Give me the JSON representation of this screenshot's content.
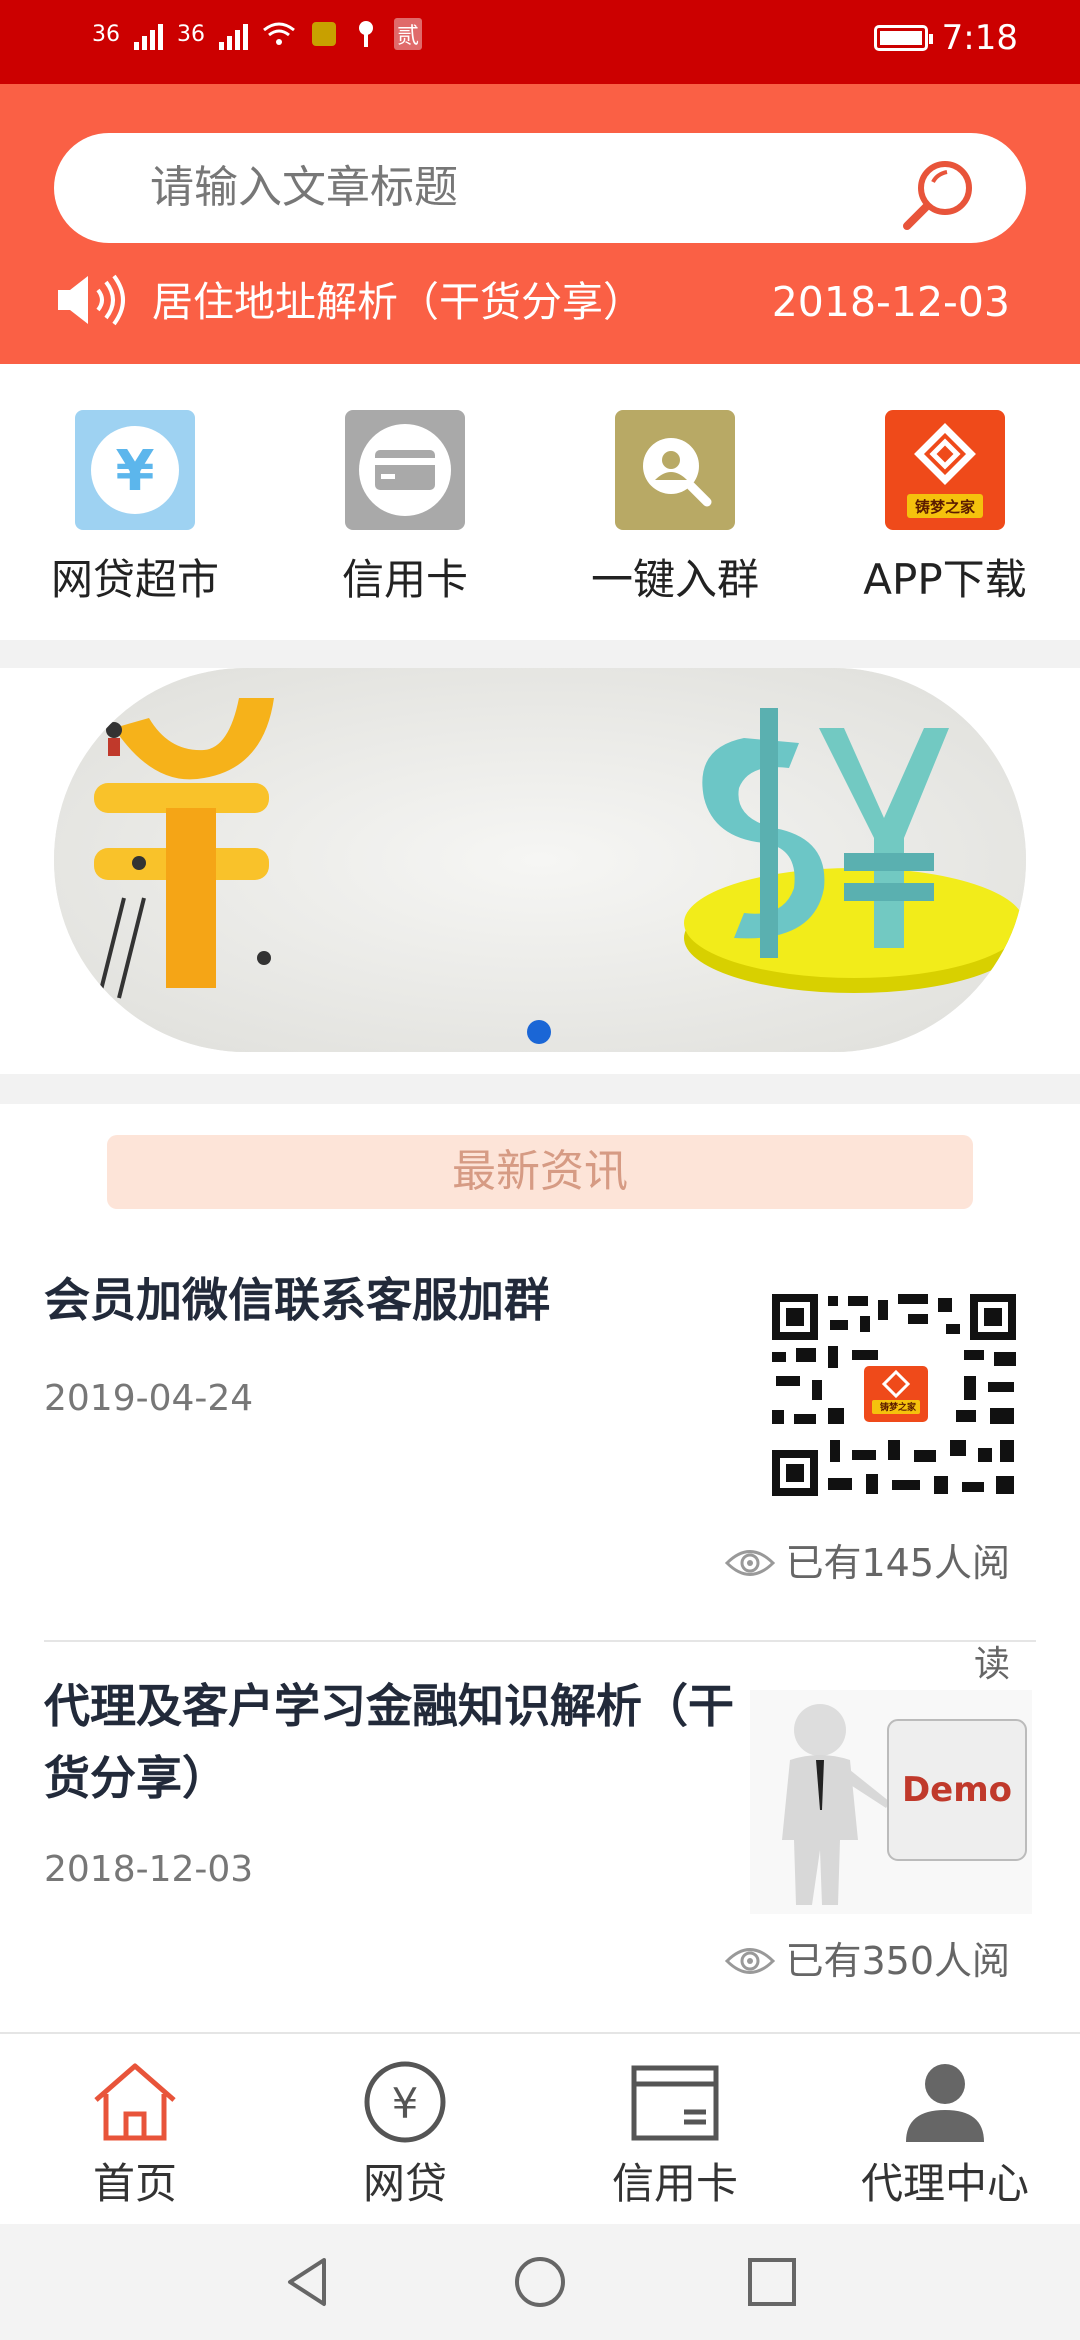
{
  "status_bar": {
    "signal1": "36",
    "signal2": "36",
    "badge": "贰",
    "time": "7:18"
  },
  "search": {
    "placeholder": "请输入文章标题"
  },
  "notice": {
    "text": "居住地址解析（干货分享）",
    "date": "2018-12-03"
  },
  "quick_menu": [
    {
      "label": "网贷超市",
      "icon": "yuan-icon"
    },
    {
      "label": "信用卡",
      "icon": "credit-card-icon"
    },
    {
      "label": "一键入群",
      "icon": "group-search-icon"
    },
    {
      "label": "APP下载",
      "icon": "app-logo-icon",
      "logo_text": "铸梦之家"
    }
  ],
  "news": {
    "header": "最新资讯",
    "items": [
      {
        "title": "会员加微信联系客服加群",
        "date": "2019-04-24",
        "reads": "已有145人阅",
        "thumb": "qr-code",
        "logo_text": "铸梦之家"
      },
      {
        "title": "代理及客户学习金融知识解析（干货分享）",
        "date": "2018-12-03",
        "reads": "已有350人阅",
        "thumb": "demo-figure",
        "thumb_text": "Demo"
      }
    ],
    "trailing_char": "读"
  },
  "tabs": [
    {
      "label": "首页",
      "icon": "home-icon"
    },
    {
      "label": "网贷",
      "icon": "yuan-circle-icon"
    },
    {
      "label": "信用卡",
      "icon": "card-icon"
    },
    {
      "label": "代理中心",
      "icon": "person-icon"
    }
  ],
  "colors": {
    "status_bar": "#cc0000",
    "header": "#fa6045",
    "accent": "#e8543a",
    "banner_dot": "#1a66d6"
  }
}
